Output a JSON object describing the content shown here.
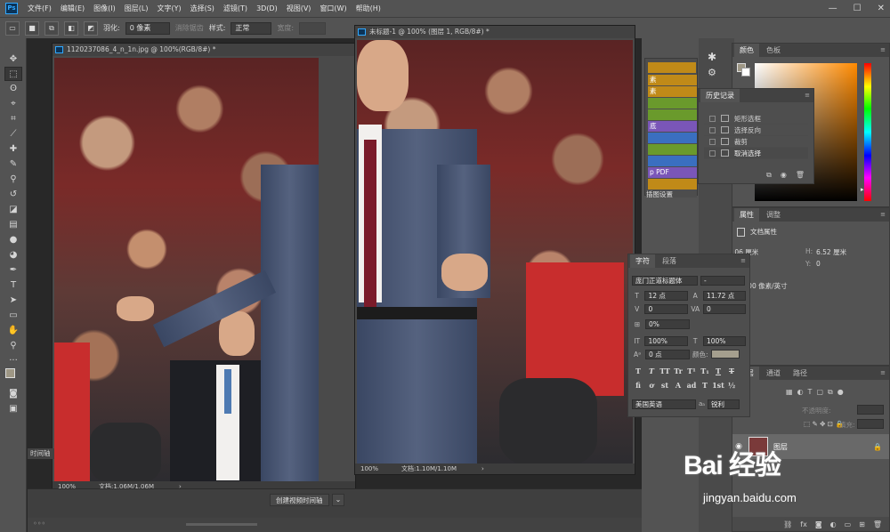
{
  "app": {
    "logo": "Ps"
  },
  "menubar": {
    "items": [
      "文件(F)",
      "编辑(E)",
      "图像(I)",
      "图层(L)",
      "文字(Y)",
      "选择(S)",
      "滤镜(T)",
      "3D(D)",
      "视图(V)",
      "窗口(W)",
      "帮助(H)"
    ],
    "minimize": "—",
    "maximize": "☐",
    "close": "✕"
  },
  "options": {
    "feather_label": "羽化:",
    "feather_value": "0 像素",
    "antialias": "消除锯齿",
    "style_label": "样式:",
    "style_value": "正常",
    "width_label": "宽度:"
  },
  "doc1": {
    "title": "1120237086_4_n_1n.jpg @ 100%(RGB/8#) *",
    "zoom": "100%",
    "status": "文档:1.06M/1.06M",
    "arrow": "›"
  },
  "doc2": {
    "title": "未标题-1 @ 100% (图层 1, RGB/8#) *",
    "zoom": "100%",
    "status": "文档:1.10M/1.10M",
    "arrow": "›"
  },
  "timeline": {
    "title": "时间轴",
    "create_button": "创建视频时间轴"
  },
  "actions": {
    "items": [
      "",
      "素",
      "素",
      "",
      "",
      "底",
      "",
      "p PDF",
      "插图设置"
    ]
  },
  "history": {
    "title": "历史记录",
    "items": [
      "矩形选框",
      "选择反向",
      "裁剪",
      "取消选择"
    ]
  },
  "color": {
    "tabs": [
      "颜色",
      "色板"
    ]
  },
  "properties": {
    "tabs": [
      "属性",
      "调整"
    ],
    "doc_props": "文档属性",
    "w_value": ".06 厘米",
    "h_label": "H:",
    "h_value": "6.52 厘米",
    "y_label": "Y:",
    "y_value": "0",
    "resolution": "率: 300 像素/英寸"
  },
  "character": {
    "tabs": [
      "字符",
      "段落"
    ],
    "font_family": "庞门正道标题体",
    "font_style": "-",
    "size": "12 点",
    "leading": "11.72 点",
    "kerning": "0",
    "tracking": "0",
    "tracking_label": "VA",
    "scale_v": "100%",
    "scale_h": "100%",
    "baseline": "0 点",
    "color_label": "颜色:",
    "language": "美国英语",
    "antialias": "锐利",
    "extra_pct": "0%",
    "tt_buttons": [
      "T",
      "T",
      "TT",
      "Tr",
      "T¹",
      "T₁",
      "T",
      "T"
    ],
    "fi_buttons": [
      "fi",
      "ơ",
      "st",
      "A",
      "ad",
      "T",
      "1st",
      "½"
    ]
  },
  "layers": {
    "tabs": [
      "图层",
      "通道",
      "路径"
    ],
    "opacity_label": "不透明度:",
    "fill_label": "填充:",
    "layer_name": "图层"
  },
  "watermark": {
    "logo": "Bai 经验",
    "url": "jingyan.baidu.com"
  }
}
